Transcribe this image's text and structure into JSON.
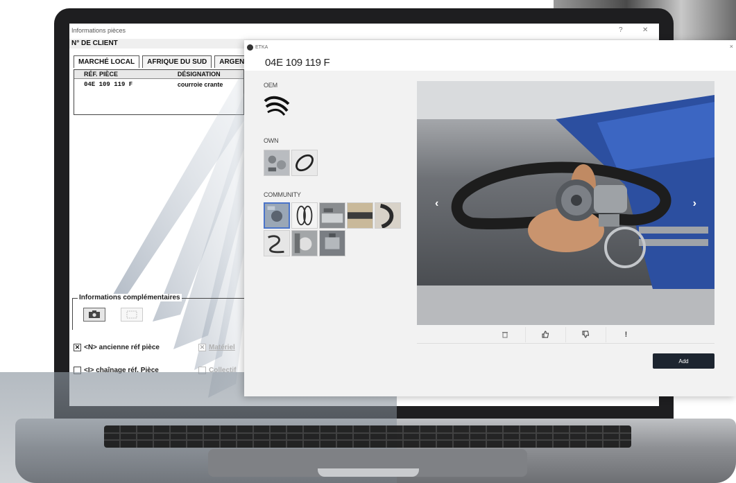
{
  "legacy": {
    "window_title": "Informations pièces",
    "help": "?",
    "close": "✕",
    "client_label": "N° DE CLIENT",
    "tabs": [
      {
        "label": "MARCHÉ LOCAL"
      },
      {
        "label": "AFRIQUE DU SUD"
      },
      {
        "label": "ARGEN"
      }
    ],
    "table": {
      "headers": [
        "RÉF. PIÈCE",
        "DÉSIGNATION"
      ],
      "rows": [
        {
          "ref": "04E 109 119 F",
          "designation": "courroie crante"
        }
      ]
    },
    "info_section": "Informations complémentaires",
    "checkboxes": [
      {
        "label": "<N> ancienne réf pièce",
        "checked": true
      },
      {
        "label": "Matériel",
        "checked": true
      },
      {
        "label": "<I> chaînage réf. Pièce",
        "checked": false
      },
      {
        "label": "Collectif",
        "checked": false
      }
    ]
  },
  "etka": {
    "app_name": "ETKA",
    "close": "×",
    "part_number": "04E 109 119 F",
    "sections": {
      "oem": "OEM",
      "own": "OWN",
      "community": "COMMUNITY"
    },
    "actions": {
      "delete": "🗑",
      "like": "👍",
      "dislike": "👎",
      "report": "!"
    },
    "add_label": "Add",
    "prev_arrow": "‹",
    "next_arrow": "›"
  }
}
